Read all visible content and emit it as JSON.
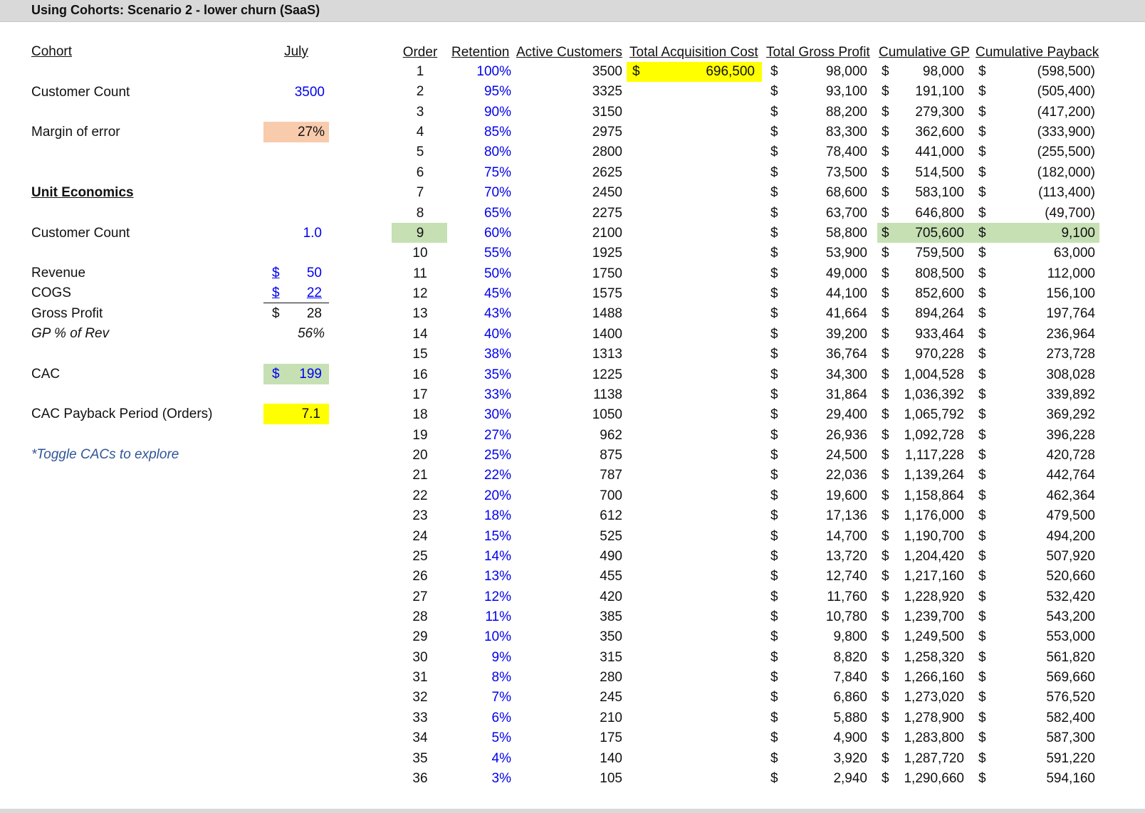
{
  "title": "Using Cohorts: Scenario 2 - lower churn (SaaS)",
  "left": {
    "cohort_label": "Cohort",
    "cohort_month": "July",
    "customer_count_label": "Customer Count",
    "customer_count_value": "3500",
    "margin_label": "Margin of error",
    "margin_value": "27%",
    "unit_econ_label": "Unit Economics",
    "unit_count_label": "Customer Count",
    "unit_count_value": "1.0",
    "revenue_label": "Revenue",
    "revenue_currency": "$",
    "revenue_value": "50",
    "cogs_label": "COGS",
    "cogs_currency": "$",
    "cogs_value": "22",
    "gp_label": "Gross Profit",
    "gp_currency": "$",
    "gp_value": "28",
    "gp_pct_label": "GP % of Rev",
    "gp_pct_value": "56%",
    "cac_label": "CAC",
    "cac_currency": "$",
    "cac_value": "199",
    "payback_label": "CAC Payback Period (Orders)",
    "payback_value": "7.1",
    "toggle_note": "*Toggle CACs to explore"
  },
  "table": {
    "headers": {
      "order": "Order",
      "retention": "Retention",
      "active": "Active Customers",
      "acq_cost": "Total Acquisition Cost",
      "gross_profit": "Total Gross Profit",
      "cum_gp": "Cumulative GP",
      "cum_payback": "Cumulative Payback"
    },
    "currency": "$",
    "acq_cost_value": "696,500",
    "rows": [
      {
        "order": "1",
        "retention": "100%",
        "active": "3500",
        "gp": "98,000",
        "cum_gp": "98,000",
        "payback": "(598,500)"
      },
      {
        "order": "2",
        "retention": "95%",
        "active": "3325",
        "gp": "93,100",
        "cum_gp": "191,100",
        "payback": "(505,400)"
      },
      {
        "order": "3",
        "retention": "90%",
        "active": "3150",
        "gp": "88,200",
        "cum_gp": "279,300",
        "payback": "(417,200)"
      },
      {
        "order": "4",
        "retention": "85%",
        "active": "2975",
        "gp": "83,300",
        "cum_gp": "362,600",
        "payback": "(333,900)"
      },
      {
        "order": "5",
        "retention": "80%",
        "active": "2800",
        "gp": "78,400",
        "cum_gp": "441,000",
        "payback": "(255,500)"
      },
      {
        "order": "6",
        "retention": "75%",
        "active": "2625",
        "gp": "73,500",
        "cum_gp": "514,500",
        "payback": "(182,000)"
      },
      {
        "order": "7",
        "retention": "70%",
        "active": "2450",
        "gp": "68,600",
        "cum_gp": "583,100",
        "payback": "(113,400)"
      },
      {
        "order": "8",
        "retention": "65%",
        "active": "2275",
        "gp": "63,700",
        "cum_gp": "646,800",
        "payback": "(49,700)"
      },
      {
        "order": "9",
        "retention": "60%",
        "active": "2100",
        "gp": "58,800",
        "cum_gp": "705,600",
        "payback": "9,100"
      },
      {
        "order": "10",
        "retention": "55%",
        "active": "1925",
        "gp": "53,900",
        "cum_gp": "759,500",
        "payback": "63,000"
      },
      {
        "order": "11",
        "retention": "50%",
        "active": "1750",
        "gp": "49,000",
        "cum_gp": "808,500",
        "payback": "112,000"
      },
      {
        "order": "12",
        "retention": "45%",
        "active": "1575",
        "gp": "44,100",
        "cum_gp": "852,600",
        "payback": "156,100"
      },
      {
        "order": "13",
        "retention": "43%",
        "active": "1488",
        "gp": "41,664",
        "cum_gp": "894,264",
        "payback": "197,764"
      },
      {
        "order": "14",
        "retention": "40%",
        "active": "1400",
        "gp": "39,200",
        "cum_gp": "933,464",
        "payback": "236,964"
      },
      {
        "order": "15",
        "retention": "38%",
        "active": "1313",
        "gp": "36,764",
        "cum_gp": "970,228",
        "payback": "273,728"
      },
      {
        "order": "16",
        "retention": "35%",
        "active": "1225",
        "gp": "34,300",
        "cum_gp": "1,004,528",
        "payback": "308,028"
      },
      {
        "order": "17",
        "retention": "33%",
        "active": "1138",
        "gp": "31,864",
        "cum_gp": "1,036,392",
        "payback": "339,892"
      },
      {
        "order": "18",
        "retention": "30%",
        "active": "1050",
        "gp": "29,400",
        "cum_gp": "1,065,792",
        "payback": "369,292"
      },
      {
        "order": "19",
        "retention": "27%",
        "active": "962",
        "gp": "26,936",
        "cum_gp": "1,092,728",
        "payback": "396,228"
      },
      {
        "order": "20",
        "retention": "25%",
        "active": "875",
        "gp": "24,500",
        "cum_gp": "1,117,228",
        "payback": "420,728"
      },
      {
        "order": "21",
        "retention": "22%",
        "active": "787",
        "gp": "22,036",
        "cum_gp": "1,139,264",
        "payback": "442,764"
      },
      {
        "order": "22",
        "retention": "20%",
        "active": "700",
        "gp": "19,600",
        "cum_gp": "1,158,864",
        "payback": "462,364"
      },
      {
        "order": "23",
        "retention": "18%",
        "active": "612",
        "gp": "17,136",
        "cum_gp": "1,176,000",
        "payback": "479,500"
      },
      {
        "order": "24",
        "retention": "15%",
        "active": "525",
        "gp": "14,700",
        "cum_gp": "1,190,700",
        "payback": "494,200"
      },
      {
        "order": "25",
        "retention": "14%",
        "active": "490",
        "gp": "13,720",
        "cum_gp": "1,204,420",
        "payback": "507,920"
      },
      {
        "order": "26",
        "retention": "13%",
        "active": "455",
        "gp": "12,740",
        "cum_gp": "1,217,160",
        "payback": "520,660"
      },
      {
        "order": "27",
        "retention": "12%",
        "active": "420",
        "gp": "11,760",
        "cum_gp": "1,228,920",
        "payback": "532,420"
      },
      {
        "order": "28",
        "retention": "11%",
        "active": "385",
        "gp": "10,780",
        "cum_gp": "1,239,700",
        "payback": "543,200"
      },
      {
        "order": "29",
        "retention": "10%",
        "active": "350",
        "gp": "9,800",
        "cum_gp": "1,249,500",
        "payback": "553,000"
      },
      {
        "order": "30",
        "retention": "9%",
        "active": "315",
        "gp": "8,820",
        "cum_gp": "1,258,320",
        "payback": "561,820"
      },
      {
        "order": "31",
        "retention": "8%",
        "active": "280",
        "gp": "7,840",
        "cum_gp": "1,266,160",
        "payback": "569,660"
      },
      {
        "order": "32",
        "retention": "7%",
        "active": "245",
        "gp": "6,860",
        "cum_gp": "1,273,020",
        "payback": "576,520"
      },
      {
        "order": "33",
        "retention": "6%",
        "active": "210",
        "gp": "5,880",
        "cum_gp": "1,278,900",
        "payback": "582,400"
      },
      {
        "order": "34",
        "retention": "5%",
        "active": "175",
        "gp": "4,900",
        "cum_gp": "1,283,800",
        "payback": "587,300"
      },
      {
        "order": "35",
        "retention": "4%",
        "active": "140",
        "gp": "3,920",
        "cum_gp": "1,287,720",
        "payback": "591,220"
      },
      {
        "order": "36",
        "retention": "3%",
        "active": "105",
        "gp": "2,940",
        "cum_gp": "1,290,660",
        "payback": "594,160"
      }
    ],
    "payback_row_index": 8
  },
  "colors": {
    "input_blue": "#0000ee",
    "highlight_yellow": "#ffff00",
    "highlight_green": "#c6e0b4",
    "highlight_peach": "#f8cbad"
  }
}
